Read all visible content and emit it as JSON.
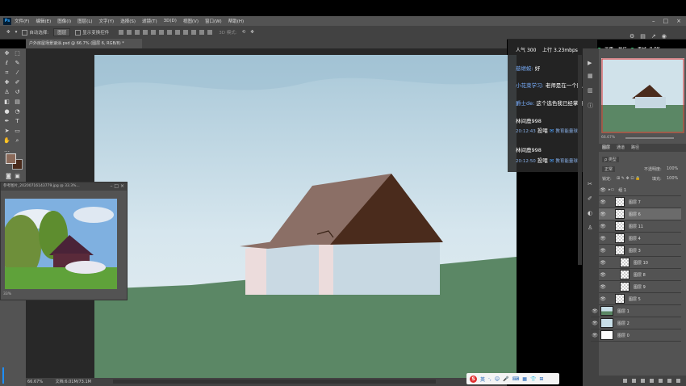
{
  "menu": {
    "items": [
      "文件(F)",
      "编辑(E)",
      "图像(I)",
      "图层(L)",
      "文字(Y)",
      "选择(S)",
      "滤镜(T)",
      "3D(D)",
      "视图(V)",
      "窗口(W)",
      "帮助(H)"
    ],
    "logo": "Ps"
  },
  "options": {
    "auto_select_label": "自动选择:",
    "auto_select_value": "图层",
    "show_transform_label": "显示变换控件",
    "mode_3d": "3D 模式:"
  },
  "document": {
    "tab_title": "户外房屋场景速涂.psd @ 66.7% (图层 6, RGB/8) *",
    "zoom": "66.67%",
    "doc_info": "文档:6.01M/73.1M"
  },
  "reference": {
    "title": "参考图片_20200716143779.jpg @ 33.3%...",
    "zoom": "33%"
  },
  "livestream": {
    "popularity_label": "人气",
    "popularity_value": "300",
    "upload_label": "上行",
    "upload_value": "3.23mbps",
    "quality_label": "画质:",
    "quality_value": "最佳",
    "loss_label": "丢帧",
    "loss_value": "0.0%"
  },
  "chat": [
    {
      "user": "慈继蛟:",
      "text": "好"
    },
    {
      "user": "小花菜学习:",
      "text": "老师是在一个图层操作的吗"
    },
    {
      "user": "爵士de:",
      "text": "这个选色我已经掌握了"
    },
    {
      "user": "林间鹿998",
      "time": "20:12:43",
      "action": "投喂",
      "gift": "教育能量球"
    },
    {
      "user": "林间鹿998",
      "time": "20:12:50",
      "action": "投喂",
      "gift": "教育能量球"
    }
  ],
  "navigator": {
    "zoom": "66.67%"
  },
  "layers_panel": {
    "tabs": [
      "图层",
      "通道",
      "路径"
    ],
    "filter_label": "ρ 类型",
    "blend_mode": "正常",
    "opacity_label": "不透明度:",
    "opacity_value": "100%",
    "lock_label": "锁定:",
    "fill_label": "填充:",
    "fill_value": "100%",
    "layers": [
      {
        "name": "组 1",
        "selected": false
      },
      {
        "name": "图层 7",
        "selected": false
      },
      {
        "name": "图层 6",
        "selected": true
      },
      {
        "name": "图层 11",
        "selected": false
      },
      {
        "name": "图层 4",
        "selected": false
      },
      {
        "name": "图层 3",
        "selected": false
      },
      {
        "name": "图层 10",
        "selected": false
      },
      {
        "name": "图层 8",
        "selected": false
      },
      {
        "name": "图层 9",
        "selected": false
      },
      {
        "name": "图层 5",
        "selected": false
      },
      {
        "name": "图层 1",
        "selected": false
      },
      {
        "name": "图层 2",
        "selected": false
      },
      {
        "name": "图层 0",
        "selected": false
      }
    ]
  },
  "ime": {
    "logo": "S",
    "label": "英"
  },
  "colors": {
    "sky": "#c9dfe8",
    "grass": "#5b8765",
    "roof_light": "#8b6f66",
    "roof_dark": "#4a2b1c",
    "wall": "#c7d8e2",
    "wall_shadow": "#ecdcdc",
    "foreground_color": "#8a6a5a",
    "background_color": "#4a2b1c"
  }
}
